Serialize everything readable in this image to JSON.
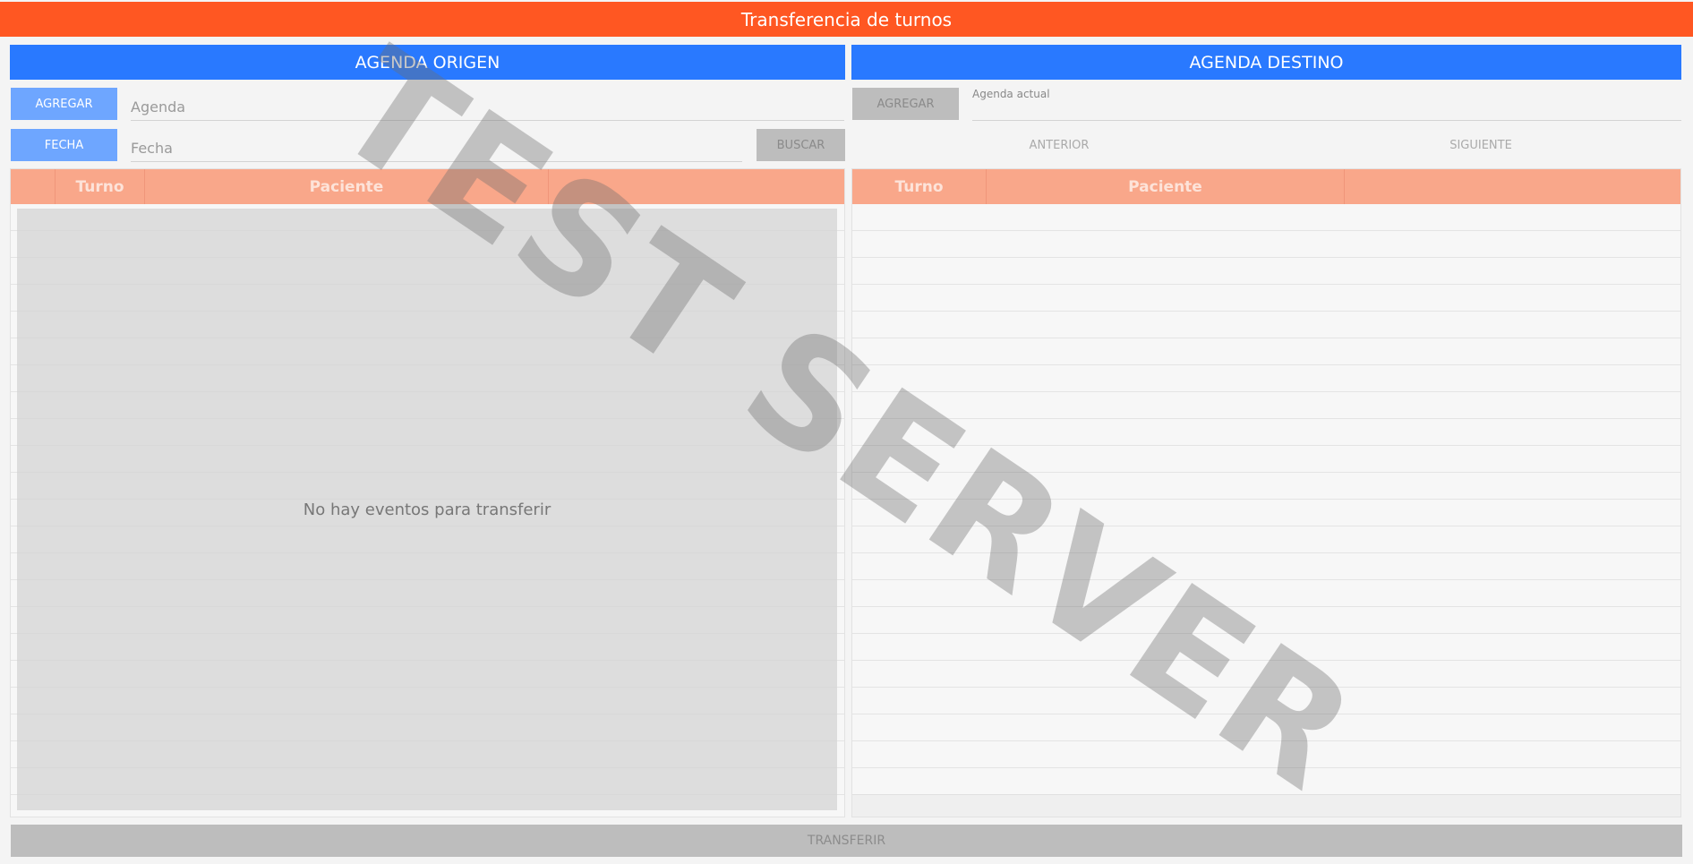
{
  "window": {
    "title": "Transferencia de turnos"
  },
  "origin": {
    "header": "AGENDA ORIGEN",
    "add_button": "AGREGAR",
    "agenda_placeholder": "Agenda",
    "date_button": "FECHA",
    "date_placeholder": "Fecha",
    "search_button": "BUSCAR",
    "columns": [
      "Turno",
      "Paciente"
    ],
    "empty_message": "No hay eventos para transferir"
  },
  "destination": {
    "header": "AGENDA DESTINO",
    "add_button": "AGREGAR",
    "agenda_label": "Agenda actual",
    "previous_button": "ANTERIOR",
    "next_button": "SIGUIENTE",
    "columns": [
      "Turno",
      "Paciente"
    ]
  },
  "footer": {
    "transfer_button": "TRANSFERIR"
  },
  "watermark": "TEST SERVER",
  "colors": {
    "title_bar": "#ff5722",
    "panel_header": "#2979ff",
    "table_header": "#f9a78a",
    "primary_button": "#6ea6ff",
    "disabled_button": "#bdbdbd"
  }
}
